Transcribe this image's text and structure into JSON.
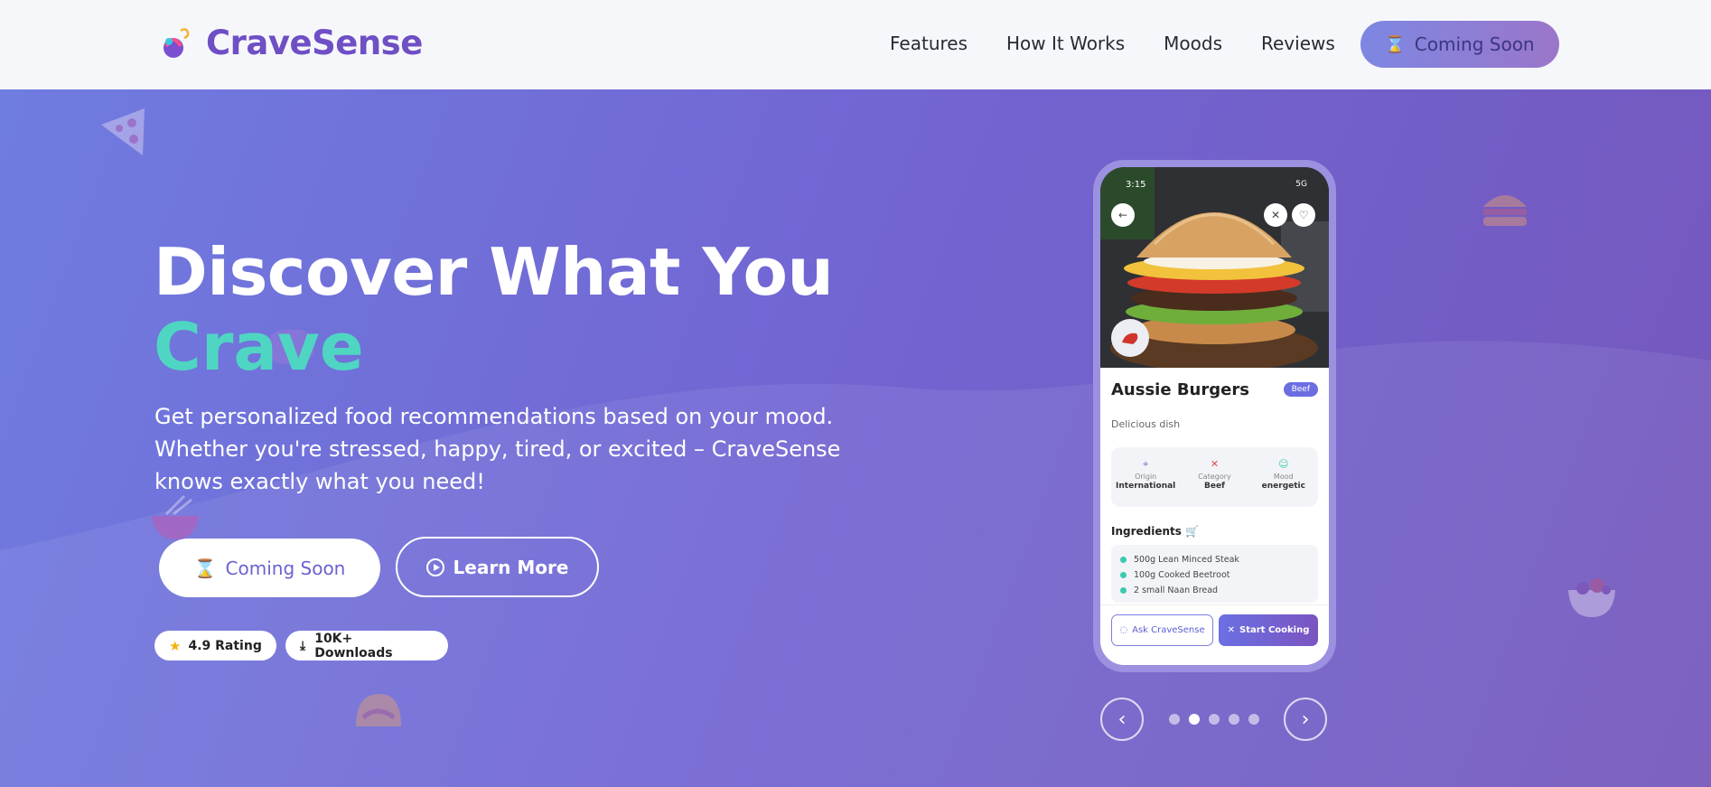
{
  "nav": {
    "brand": "CraveSense",
    "links": [
      "Features",
      "How It Works",
      "Moods",
      "Reviews"
    ],
    "cta_label": "Coming Soon",
    "cta_icon": "hourglass-icon"
  },
  "hero": {
    "heading_line1": "Discover What You",
    "heading_line2": "Crave",
    "lead": "Get personalized food recommendations based on your mood. Whether you're stressed, happy, tired, or excited – CraveSense knows exactly what you need!",
    "primary_button": "Coming Soon",
    "secondary_button": "Learn More",
    "rating_badge": "4.9 Rating",
    "downloads_badge": "10K+ Downloads",
    "accent_color": "#4fd6c2"
  },
  "phone": {
    "time": "3:15",
    "signal": "5G",
    "dish_title": "Aussie Burgers",
    "dish_tag": "Beef",
    "dish_desc": "Delicious dish",
    "meta": [
      {
        "label": "Origin",
        "value": "International"
      },
      {
        "label": "Category",
        "value": "Beef"
      },
      {
        "label": "Mood",
        "value": "energetic"
      }
    ],
    "ingredients_title": "Ingredients 🛒",
    "ingredients": [
      "500g Lean Minced Steak",
      "100g Cooked Beetroot",
      "2 small Naan Bread"
    ],
    "ask_button": "Ask CraveSense",
    "cook_button": "Start Cooking"
  },
  "carousel": {
    "slides": 5,
    "active_index": 1
  }
}
